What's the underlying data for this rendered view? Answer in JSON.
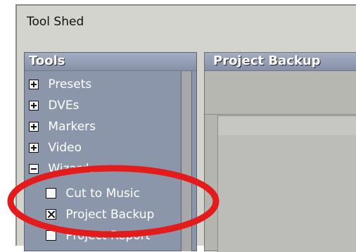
{
  "window": {
    "title": "Tool Shed"
  },
  "left_panel": {
    "header": "Tools",
    "tree": [
      {
        "label": "Presets",
        "state": "expand"
      },
      {
        "label": "DVEs",
        "state": "expand"
      },
      {
        "label": "Markers",
        "state": "expand"
      },
      {
        "label": "Video",
        "state": "expand"
      },
      {
        "label": "Wizards",
        "state": "collapse"
      }
    ],
    "wizard_items": [
      {
        "label": "Cut to Music",
        "checked": false
      },
      {
        "label": "Project Backup",
        "checked": true
      },
      {
        "label": "Project Report",
        "checked": false
      }
    ]
  },
  "right_panel": {
    "header": "Project Backup"
  },
  "colors": {
    "panel_blue": "#8c96ab",
    "window_gray": "#d4d4cf",
    "annotation_red": "#e31b1b"
  }
}
